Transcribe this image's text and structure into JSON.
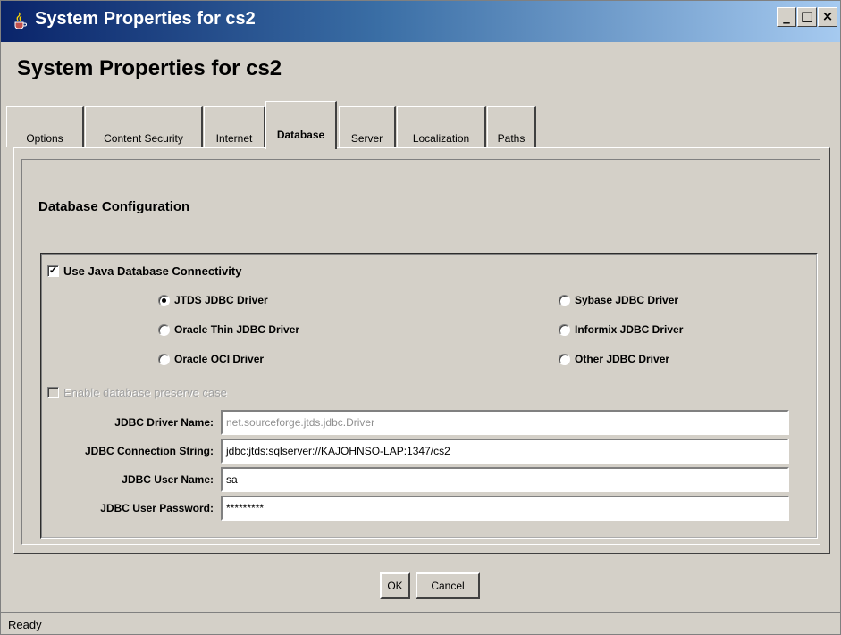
{
  "window": {
    "title": "System Properties for cs2",
    "icon": "java-coffee-icon",
    "titlebar_color": "#0a246a",
    "minimize_label": "_",
    "maximize_label": "□",
    "close_label": "×"
  },
  "heading": "System Properties for cs2",
  "tabs": [
    {
      "label": "Options"
    },
    {
      "label": "Content Security"
    },
    {
      "label": "Internet"
    },
    {
      "label": "Database",
      "active": true
    },
    {
      "label": "Server"
    },
    {
      "label": "Localization"
    },
    {
      "label": "Paths"
    }
  ],
  "section_title": "Database Configuration",
  "jdbc": {
    "use_label": "Use Java Database Connectivity",
    "use_checked": true,
    "drivers": [
      {
        "label": "JTDS JDBC Driver",
        "selected": true
      },
      {
        "label": "Oracle Thin JDBC Driver",
        "selected": false
      },
      {
        "label": "Oracle OCI Driver",
        "selected": false
      },
      {
        "label": "Sybase JDBC Driver",
        "selected": false
      },
      {
        "label": "Informix JDBC Driver",
        "selected": false
      },
      {
        "label": "Other JDBC Driver",
        "selected": false
      }
    ],
    "preserve_case_label": "Enable database preserve case",
    "preserve_case_checked": false
  },
  "fields": {
    "driver_name": {
      "label": "JDBC Driver Name:",
      "value": "net.sourceforge.jtds.jdbc.Driver"
    },
    "connection_string": {
      "label": "JDBC Connection String:",
      "value": "jdbc:jtds:sqlserver://KAJOHNSO-LAP:1347/cs2"
    },
    "user_name": {
      "label": "JDBC User Name:",
      "value": "sa"
    },
    "user_password": {
      "label": "JDBC User Password:",
      "value": "*********"
    }
  },
  "buttons": {
    "ok": "OK",
    "cancel": "Cancel"
  },
  "status": "Ready"
}
